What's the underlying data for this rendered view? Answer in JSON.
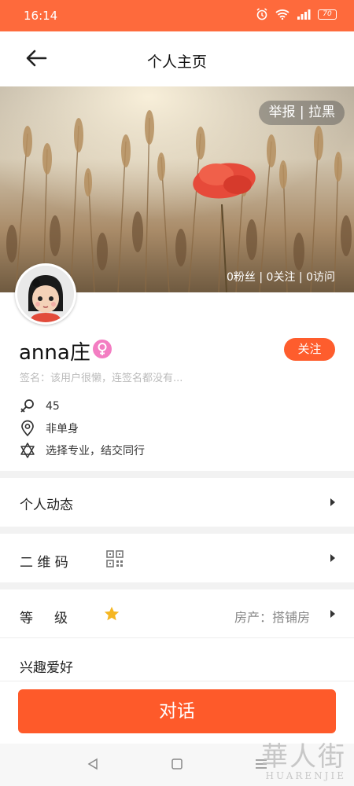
{
  "status_bar": {
    "time": "16:14",
    "battery": "70"
  },
  "header": {
    "title": "个人主页"
  },
  "banner": {
    "report_label": "举报",
    "block_label": "拉黑",
    "fans": "0粉丝",
    "following": "0关注",
    "visits": "0访问"
  },
  "profile": {
    "name": "anna庄",
    "gender_symbol": "♀",
    "follow_label": "关注",
    "signature": "签名：该用户很懒，连签名都没有..."
  },
  "info": {
    "age": "45",
    "relationship": "非单身",
    "profession": "选择专业，结交同行"
  },
  "menu": {
    "activity": "个人动态",
    "qrcode": "二 维 码",
    "level": "等     级",
    "property": "房产：搭铺房",
    "interests": "兴趣爱好"
  },
  "actions": {
    "chat": "对话"
  },
  "watermark": {
    "brand": "華人街",
    "sub": "HUARENJIE"
  },
  "colors": {
    "accent": "#fe6a3c",
    "button": "#fe5a2a",
    "gender": "#f37dc2",
    "star": "#f5b622"
  }
}
